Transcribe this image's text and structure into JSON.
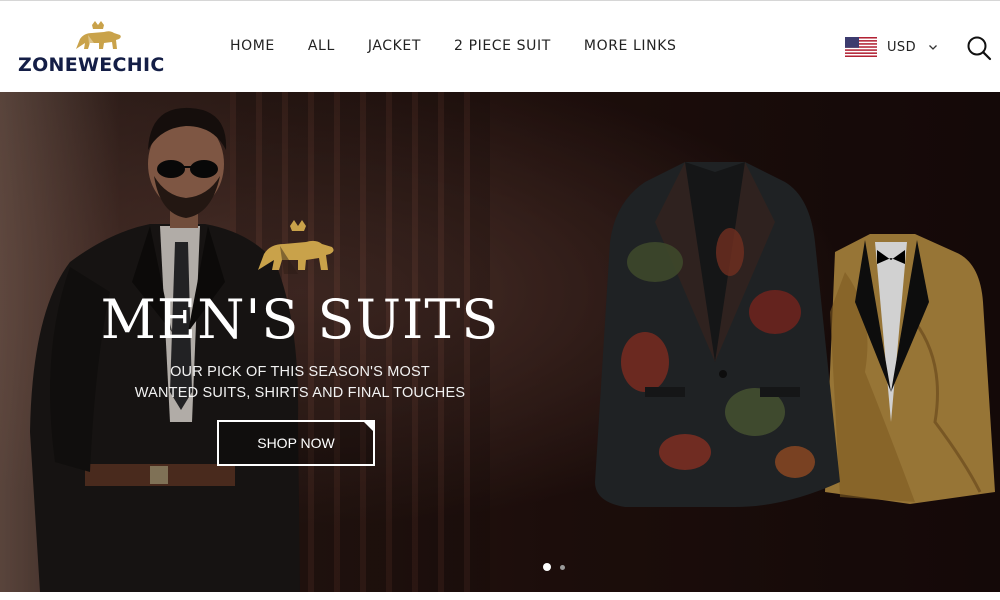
{
  "brand": {
    "name": "ZONEWECHIC",
    "logo_icon": "lion-crown-logo-icon",
    "logo_color": "#c9a24a",
    "text_color": "#141e46"
  },
  "nav": {
    "items": [
      {
        "label": "HOME"
      },
      {
        "label": "ALL"
      },
      {
        "label": "JACKET"
      },
      {
        "label": "2 PIECE SUIT"
      },
      {
        "label": "MORE LINKS"
      }
    ]
  },
  "currency": {
    "flag_icon": "us-flag-icon",
    "code": "USD",
    "dropdown_icon": "chevron-down-icon"
  },
  "search": {
    "icon": "search-icon"
  },
  "hero": {
    "crest_icon": "lion-crown-logo-icon",
    "title": "MEN'S SUITS",
    "subtitle_line1": "OUR PICK OF THIS SEASON'S MOST",
    "subtitle_line2": "WANTED SUITS, SHIRTS AND FINAL TOUCHES",
    "cta_label": "SHOP NOW",
    "slides_total": 2,
    "active_slide": 1,
    "accent_gold": "#c9a24a"
  }
}
